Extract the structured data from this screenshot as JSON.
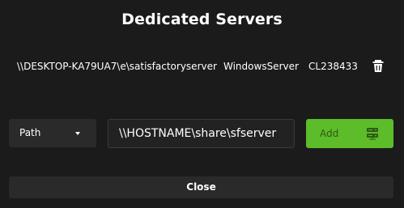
{
  "dialog": {
    "title": "Dedicated Servers"
  },
  "servers": [
    {
      "path": "\\\\DESKTOP-KA79UA7\\e\\satisfactoryserver",
      "type": "WindowsServer",
      "cl": "CL238433",
      "delete_icon": "trash-icon"
    }
  ],
  "add_form": {
    "type_select": {
      "selected": "Path",
      "icon": "chevron-down-icon"
    },
    "path_input": {
      "value": "\\\\HOSTNAME\\share\\sfserver",
      "placeholder": ""
    },
    "add_button": {
      "label": "Add",
      "icon": "server-icon"
    }
  },
  "close_button": {
    "label": "Close"
  },
  "colors": {
    "background": "#1b1b1b",
    "panel": "#2a2a2a",
    "accent": "#5cbc29",
    "text": "#ffffff"
  }
}
